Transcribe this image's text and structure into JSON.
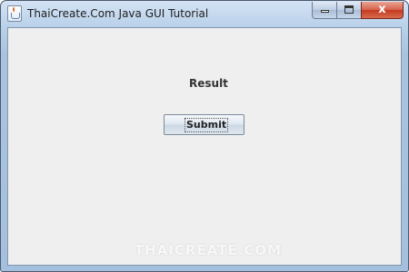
{
  "window": {
    "title": "ThaiCreate.Com Java GUI Tutorial",
    "icon": "java-cup-icon",
    "controls": {
      "minimize_icon": "minimize-icon",
      "maximize_icon": "maximize-icon",
      "close_icon": "close-icon",
      "close_glyph": "x"
    }
  },
  "main": {
    "result_label": "Result",
    "submit_label": "Submit"
  },
  "watermark": {
    "text": "THAICREATE.COM"
  },
  "colors": {
    "window_bg": "#efefef",
    "titlebar": "#b9d1ea",
    "close_button": "#c43a1f",
    "button_border": "#7a8a99"
  }
}
